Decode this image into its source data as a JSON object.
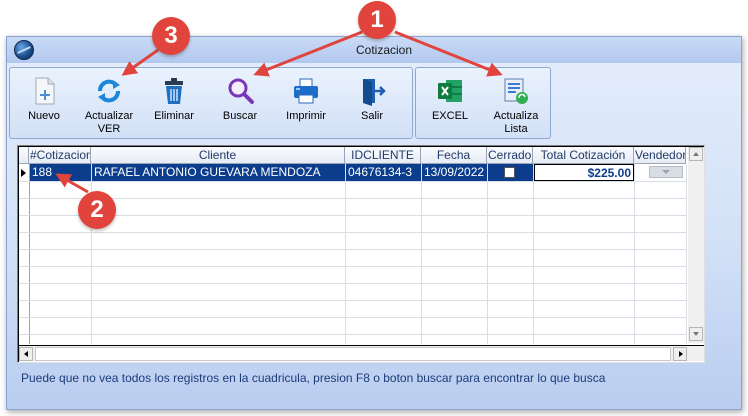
{
  "window": {
    "title": "Cotizacion"
  },
  "toolbar": {
    "main": [
      {
        "id": "nuevo",
        "label": "Nuevo",
        "icon": "new-document-icon"
      },
      {
        "id": "actualizar-ver",
        "label": "Actualizar\nVER",
        "icon": "refresh-icon"
      },
      {
        "id": "eliminar",
        "label": "Eliminar",
        "icon": "trash-icon"
      },
      {
        "id": "buscar",
        "label": "Buscar",
        "icon": "magnifier-icon"
      },
      {
        "id": "imprimir",
        "label": "Imprimir",
        "icon": "printer-icon"
      },
      {
        "id": "salir",
        "label": "Salir",
        "icon": "exit-door-icon"
      }
    ],
    "secondary": [
      {
        "id": "excel",
        "label": "EXCEL",
        "icon": "excel-icon"
      },
      {
        "id": "actualiza-lista",
        "label": "Actualiza\nLista",
        "icon": "list-refresh-icon"
      }
    ]
  },
  "grid": {
    "columns": [
      "#Cotizacion",
      "Cliente",
      "IDCLIENTE",
      "Fecha",
      "Cerrado",
      "Total Cotización",
      "Vendedor"
    ],
    "rows": [
      {
        "cotizacion": "188",
        "cliente": "RAFAEL ANTONIO GUEVARA MENDOZA",
        "idcliente": "04676134-3",
        "fecha": "13/09/2022",
        "cerrado": false,
        "total": "$225.00",
        "vendedor": ""
      }
    ]
  },
  "footer": {
    "note": "Puede que no vea todos los registros en la cuadricula, presion F8 o boton buscar para encontrar lo que busca"
  },
  "callouts": [
    "1",
    "2",
    "3"
  ],
  "colors": {
    "callout": "#e0443c",
    "selection": "#0b3d8c",
    "header_text": "#1f3a6a"
  }
}
